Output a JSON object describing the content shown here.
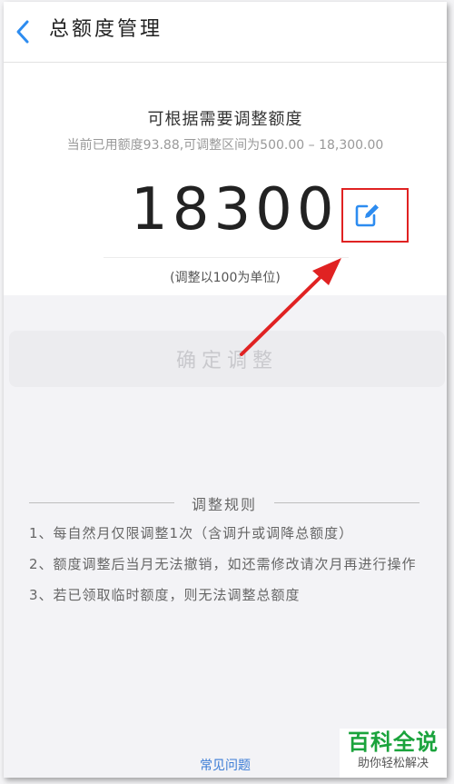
{
  "header": {
    "title": "总额度管理"
  },
  "adjust": {
    "subtitle": "可根据需要调整额度",
    "range_text": "当前已用额度93.88,可调整区间为500.00 – 18,300.00",
    "amount": "18300",
    "unit_note": "(调整以100为单位)"
  },
  "confirm_label": "确定调整",
  "rules": {
    "title": "调整规则",
    "items": [
      "1、每自然月仅限调整1次（含调升或调降总额度）",
      "2、额度调整后当月无法撤销，如还需修改请次月再进行操作",
      "3、若已领取临时额度，则无法调整总额度"
    ]
  },
  "faq_label": "常见问题",
  "watermark": {
    "main": "百科全说",
    "sub": "助你轻松解决"
  },
  "colors": {
    "accent_blue": "#2d8cf0",
    "annotation_red": "#e02222"
  },
  "icons": {
    "back": "chevron-left-icon",
    "edit": "edit-pencil-icon"
  }
}
